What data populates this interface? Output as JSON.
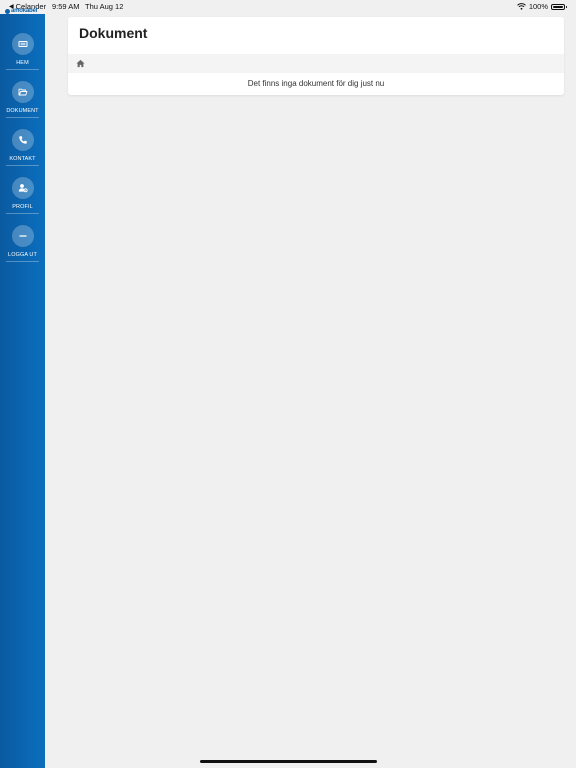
{
  "status_bar": {
    "back_app": "Celander",
    "time": "9:59 AM",
    "date": "Thu Aug 12",
    "battery_percent": "100%",
    "battery_level": 1.0,
    "logo_text": "amokabel"
  },
  "sidebar": {
    "items": [
      {
        "label": "HEM",
        "icon": "list-card-icon"
      },
      {
        "label": "DOKUMENT",
        "icon": "folder-open-icon"
      },
      {
        "label": "KONTAKT",
        "icon": "phone-icon"
      },
      {
        "label": "PROFIL",
        "icon": "user-settings-icon"
      },
      {
        "label": "LOGGA UT",
        "icon": "minus-icon"
      }
    ],
    "colors": {
      "background": "#0b6fbe",
      "circle": "rgba(255,255,255,0.25)"
    }
  },
  "main": {
    "title": "Dokument",
    "breadcrumb_icon": "home-icon",
    "empty_message": "Det finns inga dokument för dig just nu"
  }
}
